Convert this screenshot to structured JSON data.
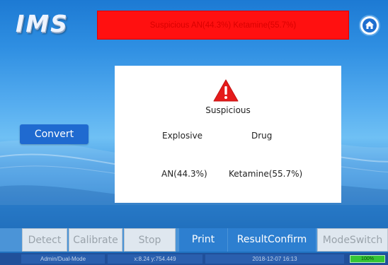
{
  "app": {
    "logo_text": "IMS"
  },
  "banner": {
    "text": "Suspicious  AN(44.3%) Ketamine(55.7%)",
    "background_color": "#ff1010"
  },
  "home": {
    "icon": "home-icon"
  },
  "convert": {
    "label": "Convert"
  },
  "result": {
    "icon": "warning-icon",
    "title": "Suspicious",
    "columns": [
      {
        "header": "Explosive",
        "value": "AN(44.3%)"
      },
      {
        "header": "Drug",
        "value": "Ketamine(55.7%)"
      }
    ],
    "alert_color": "#e51b1b"
  },
  "toolbar": {
    "buttons": [
      {
        "label": "Detect",
        "enabled": false
      },
      {
        "label": "Calibrate",
        "enabled": false
      },
      {
        "label": "Stop",
        "enabled": false
      },
      {
        "label": "Print",
        "enabled": true
      },
      {
        "label": "ResultConfirm",
        "enabled": true
      },
      {
        "label": "ModeSwitch",
        "enabled": false
      }
    ]
  },
  "status_bar": {
    "user_mode": "Admin/Dual-Mode",
    "coordinates": "x:8.24 y:754.449",
    "datetime": "2018-12-07 16:13",
    "battery_label": "100%",
    "battery_level": 1.0
  }
}
